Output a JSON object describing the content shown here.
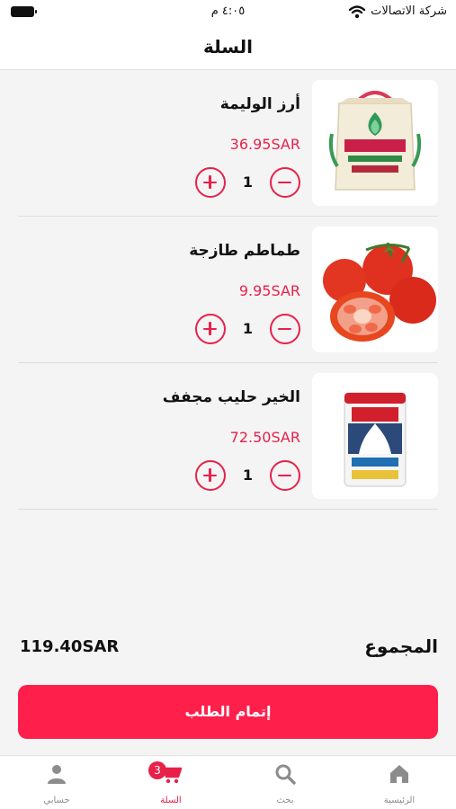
{
  "status_bar": {
    "carrier": "شركة الاتصالات",
    "time": "٤:٠٥ م"
  },
  "header": {
    "title": "السلة"
  },
  "cart": {
    "currency": "SAR",
    "items": [
      {
        "name": "أرز الوليمة",
        "price": "36.95SAR",
        "quantity": "1",
        "image_icon": "rice-bag-image"
      },
      {
        "name": "طماطم طازجة",
        "price": "9.95SAR",
        "quantity": "1",
        "image_icon": "tomatoes-image"
      },
      {
        "name": "الخير حليب مجفف",
        "price": "72.50SAR",
        "quantity": "1",
        "image_icon": "milk-powder-can-image"
      }
    ],
    "total_label": "المجموع",
    "total_value": "119.40SAR",
    "checkout_label": "إتمام الطلب"
  },
  "tabbar": {
    "tabs": [
      {
        "label": "الرئيسية",
        "icon": "home-icon"
      },
      {
        "label": "بحث",
        "icon": "search-icon"
      },
      {
        "label": "السلة",
        "icon": "cart-icon",
        "badge": "3",
        "active": true
      },
      {
        "label": "حسابي",
        "icon": "user-icon"
      }
    ]
  },
  "colors": {
    "accent": "#ff1f4b",
    "price": "#e8214b",
    "background": "#f4f4f4"
  }
}
